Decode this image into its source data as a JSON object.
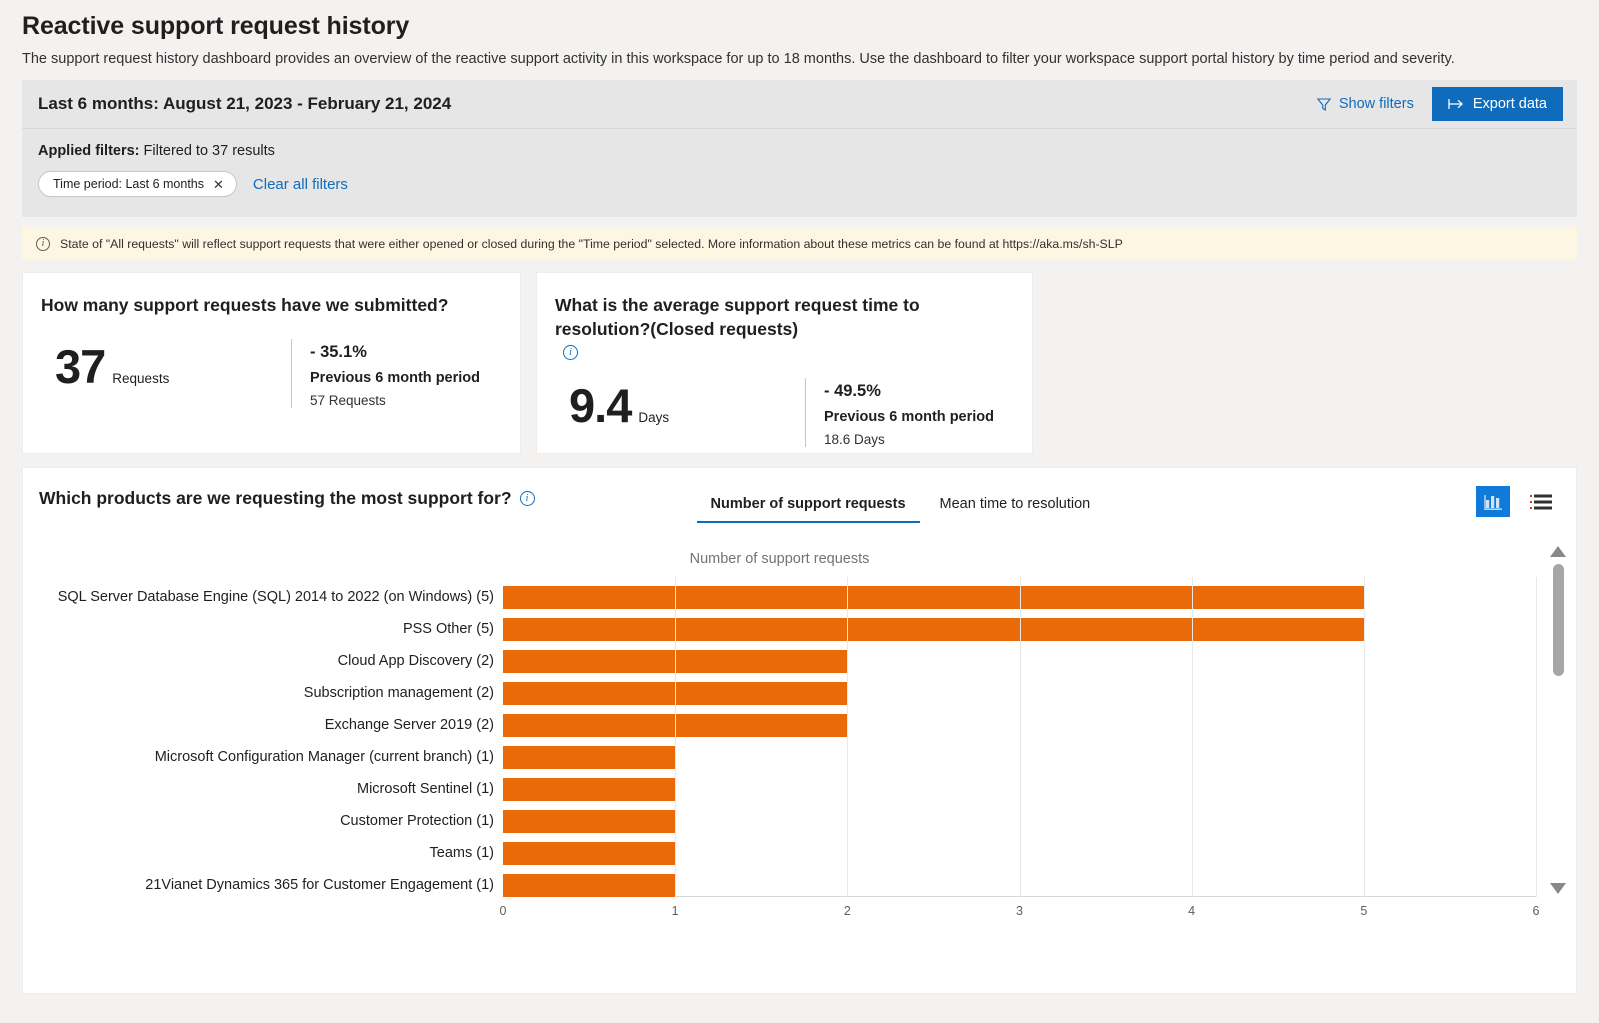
{
  "page": {
    "title": "Reactive support request history",
    "description": "The support request history dashboard provides an overview of the reactive support activity in this workspace for up to 18 months. Use the dashboard to filter your workspace support portal history by time period and severity."
  },
  "filter_panel": {
    "range_label": "Last 6 months: August 21, 2023 - February 21, 2024",
    "show_filters_label": "Show filters",
    "export_label": "Export data",
    "applied_filters_label": "Applied filters:",
    "applied_filters_value": "Filtered to 37 results",
    "chip_label": "Time period: Last 6 months",
    "chip_close": "✕",
    "clear_all_label": "Clear all filters"
  },
  "info_banner": {
    "icon": "info-icon",
    "text": "State of \"All requests\" will reflect support requests that were either opened or closed during the \"Time period\" selected. More information about these metrics can be found at https://aka.ms/sh-SLP"
  },
  "kpi_cards": [
    {
      "question": "How many support requests have we submitted?",
      "has_info_icon": false,
      "value": "37",
      "unit": "Requests",
      "delta": "- 35.1%",
      "previous_label": "Previous 6 month period",
      "previous_value": "57 Requests"
    },
    {
      "question": "What is the average support request time to resolution?(Closed requests)",
      "has_info_icon": true,
      "value": "9.4",
      "unit": "Days",
      "delta": "- 49.5%",
      "previous_label": "Previous 6 month period",
      "previous_value": "18.6 Days"
    }
  ],
  "chart_section": {
    "question": "Which products are we requesting the most support for?",
    "tabs": [
      {
        "label": "Number of support requests",
        "active": true
      },
      {
        "label": "Mean time to resolution",
        "active": false
      }
    ],
    "view_toggle": [
      {
        "icon": "bar-chart-icon",
        "active": true
      },
      {
        "icon": "list-view-icon",
        "active": false
      }
    ]
  },
  "chart_data": {
    "type": "bar",
    "orientation": "horizontal",
    "title": "Number of support requests",
    "xlabel": "",
    "ylabel": "",
    "xlim": [
      0,
      6
    ],
    "xticks": [
      0,
      1,
      2,
      3,
      4,
      5,
      6
    ],
    "grid": true,
    "bar_color": "#EA6A0A",
    "categories": [
      "SQL Server  Database Engine (SQL)  2014 to 2022 (on Windows) (5)",
      "PSS Other (5)",
      "Cloud App Discovery (2)",
      "Subscription management (2)",
      "Exchange Server 2019 (2)",
      "Microsoft Configuration Manager (current branch) (1)",
      "Microsoft Sentinel (1)",
      "Customer Protection (1)",
      "Teams (1)",
      "21Vianet Dynamics 365 for Customer Engagement (1)"
    ],
    "values": [
      5,
      5,
      2,
      2,
      2,
      1,
      1,
      1,
      1,
      1
    ]
  },
  "colors": {
    "accent": "#0f6cbd",
    "bar": "#EA6A0A",
    "banner_bg": "#fdf6e3",
    "panel_bg": "#e6e6e6"
  }
}
